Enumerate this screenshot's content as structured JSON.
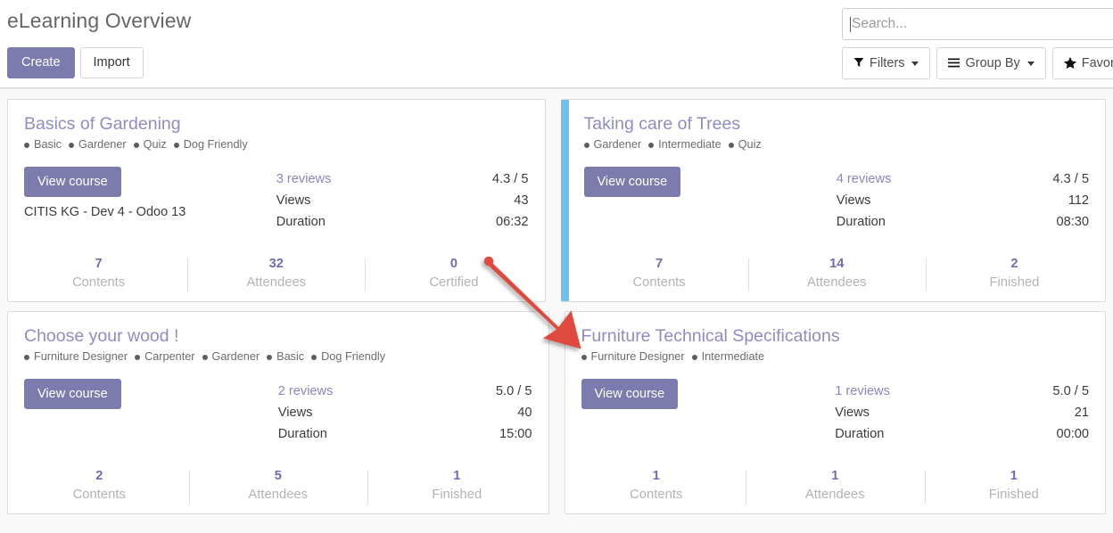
{
  "header": {
    "title": "eLearning Overview",
    "create_label": "Create",
    "import_label": "Import",
    "search": {
      "placeholder": "Search...",
      "value": ""
    },
    "filters_label": "Filters",
    "group_by_label": "Group By",
    "favorites_label": "Favorites"
  },
  "labels": {
    "view_course": "View course",
    "views": "Views",
    "duration": "Duration",
    "contents": "Contents",
    "attendees": "Attendees",
    "certified": "Certified",
    "finished": "Finished"
  },
  "colors": {
    "brand_purple": "#7C7BAD",
    "title_purple": "#8F8CC4",
    "accent_blue": "#6EC1EF",
    "stat_number": "#6F6CB0",
    "annotation_red": "#E0483C",
    "body_bg": "#F9F9F9"
  },
  "cards": [
    {
      "title": "Basics of Gardening",
      "tags": [
        "Basic",
        "Gardener",
        "Quiz",
        "Dog Friendly"
      ],
      "subtext": "CITIS KG - Dev 4 - Odoo 13",
      "reviews_label": "3 reviews",
      "rating": "4.3 / 5",
      "views_label": "Views",
      "views": "43",
      "duration_label": "Duration",
      "duration": "06:32",
      "accent": false,
      "stats": [
        {
          "value": "7",
          "label": "Contents"
        },
        {
          "value": "32",
          "label": "Attendees"
        },
        {
          "value": "0",
          "label": "Certified"
        }
      ]
    },
    {
      "title": "Taking care of Trees",
      "tags": [
        "Gardener",
        "Intermediate",
        "Quiz"
      ],
      "subtext": "",
      "reviews_label": "4 reviews",
      "rating": "4.3 / 5",
      "views_label": "Views",
      "views": "112",
      "duration_label": "Duration",
      "duration": "08:30",
      "accent": true,
      "stats": [
        {
          "value": "7",
          "label": "Contents"
        },
        {
          "value": "14",
          "label": "Attendees"
        },
        {
          "value": "2",
          "label": "Finished"
        }
      ]
    },
    {
      "title": "Choose your wood !",
      "tags": [
        "Furniture Designer",
        "Carpenter",
        "Gardener",
        "Basic",
        "Dog Friendly"
      ],
      "subtext": "",
      "reviews_label": "2 reviews",
      "rating": "5.0 / 5",
      "views_label": "Views",
      "views": "40",
      "duration_label": "Duration",
      "duration": "15:00",
      "accent": false,
      "stats": [
        {
          "value": "2",
          "label": "Contents"
        },
        {
          "value": "5",
          "label": "Attendees"
        },
        {
          "value": "1",
          "label": "Finished"
        }
      ]
    },
    {
      "title": "Furniture Technical Specifications",
      "tags": [
        "Furniture Designer",
        "Intermediate"
      ],
      "subtext": "",
      "reviews_label": "1 reviews",
      "rating": "5.0 / 5",
      "views_label": "Views",
      "views": "21",
      "duration_label": "Duration",
      "duration": "00:00",
      "accent": false,
      "stats": [
        {
          "value": "1",
          "label": "Contents"
        },
        {
          "value": "1",
          "label": "Attendees"
        },
        {
          "value": "1",
          "label": "Finished"
        }
      ]
    }
  ],
  "annotation": {
    "type": "arrow",
    "color": "#E0483C",
    "points_to": "Furniture Technical Specifications"
  }
}
